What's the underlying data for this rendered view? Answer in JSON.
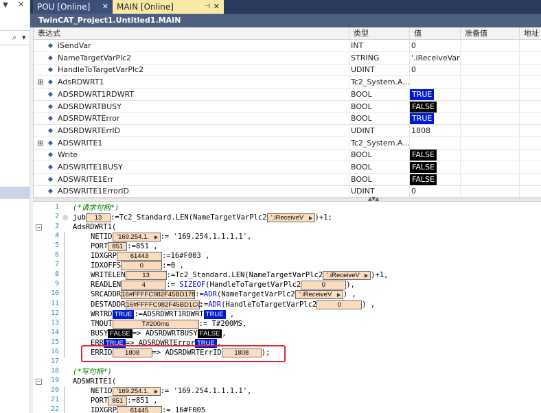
{
  "left_panel": {
    "search_icon_glyph": "⌕",
    "dropdown_glyph": "▾"
  },
  "tabs": [
    {
      "label": "POU [Online]",
      "active": false
    },
    {
      "label": "MAIN [Online]",
      "active": true
    }
  ],
  "window_title": "TwinCAT_Project1.Untitled1.MAIN",
  "watch_table": {
    "columns": [
      "表达式",
      "类型",
      "值",
      "准备值",
      "地址"
    ],
    "rows": [
      {
        "expand": "",
        "name": "iSendVar",
        "type": "INT",
        "value": "0",
        "kind": "text"
      },
      {
        "expand": "",
        "name": "NameTargetVarPlc2",
        "type": "STRING",
        "value": "'.iReceiveVar'",
        "kind": "text"
      },
      {
        "expand": "",
        "name": "HandleToTargetVarPlc2",
        "type": "UDINT",
        "value": "0",
        "kind": "text"
      },
      {
        "expand": "⊞",
        "name": "AdsRDWRT1",
        "type": "Tc2_System.A...",
        "value": "",
        "kind": "text"
      },
      {
        "expand": "",
        "name": "ADSRDWRT1RDWRT",
        "type": "BOOL",
        "value": "TRUE",
        "kind": "true"
      },
      {
        "expand": "",
        "name": "ADSRDWRTBUSY",
        "type": "BOOL",
        "value": "FALSE",
        "kind": "false"
      },
      {
        "expand": "",
        "name": "ADSRDWRTError",
        "type": "BOOL",
        "value": "TRUE",
        "kind": "true"
      },
      {
        "expand": "",
        "name": "ADSRDWRTErrID",
        "type": "UDINT",
        "value": "1808",
        "kind": "text"
      },
      {
        "expand": "⊞",
        "name": "ADSWRITE1",
        "type": "Tc2_System.A...",
        "value": "",
        "kind": "text"
      },
      {
        "expand": "",
        "name": "Write",
        "type": "BOOL",
        "value": "FALSE",
        "kind": "false"
      },
      {
        "expand": "",
        "name": "ADSWRITE1BUSY",
        "type": "BOOL",
        "value": "FALSE",
        "kind": "false"
      },
      {
        "expand": "",
        "name": "ADSWRITE1Err",
        "type": "BOOL",
        "value": "FALSE",
        "kind": "false"
      },
      {
        "expand": "",
        "name": "ADSWRITE1ErrorID",
        "type": "UDINT",
        "value": "0",
        "kind": "text"
      }
    ]
  },
  "code_lines": [
    {
      "n": "1",
      "fold": "",
      "indent": 0,
      "parts": [
        {
          "c": "(*请求句柄*)",
          "k": "cm"
        }
      ]
    },
    {
      "n": "2",
      "fold": "",
      "indent": 0,
      "parts": [
        {
          "c": "jub",
          "k": ""
        },
        {
          "c": "13",
          "k": "std",
          "w": 36
        },
        {
          "c": ":=Tc2_Standard.LEN(NameTargetVarPlc2",
          "k": ""
        },
        {
          "c": "'.iReceiveV",
          "k": "str",
          "w": 70
        },
        {
          "c": ")+1;",
          "k": ""
        }
      ]
    },
    {
      "n": "3",
      "fold": "⊟",
      "indent": 0,
      "parts": [
        {
          "c": "AdsRDWRT1(",
          "k": ""
        }
      ]
    },
    {
      "n": "4",
      "fold": "",
      "indent": 1,
      "parts": [
        {
          "c": "NETID",
          "k": ""
        },
        {
          "c": "'169.254.1.",
          "k": "str",
          "w": 70
        },
        {
          "c": ":= '169.254.1.1.1.1',",
          "k": ""
        }
      ]
    },
    {
      "n": "5",
      "fold": "",
      "indent": 1,
      "parts": [
        {
          "c": "PORT",
          "k": ""
        },
        {
          "c": "851",
          "k": "std",
          "w": 28
        },
        {
          "c": ":=851 ,",
          "k": ""
        }
      ]
    },
    {
      "n": "6",
      "fold": "",
      "indent": 1,
      "parts": [
        {
          "c": "IDXGRP",
          "k": ""
        },
        {
          "c": "61443",
          "k": "std",
          "w": 66
        },
        {
          "c": ":=16#F003 ,",
          "k": ""
        }
      ]
    },
    {
      "n": "7",
      "fold": "",
      "indent": 1,
      "parts": [
        {
          "c": "IDXOFFS",
          "k": ""
        },
        {
          "c": "0",
          "k": "std",
          "w": 60
        },
        {
          "c": ":=0 ,",
          "k": ""
        }
      ]
    },
    {
      "n": "8",
      "fold": "",
      "indent": 1,
      "parts": [
        {
          "c": "WRITELEN",
          "k": ""
        },
        {
          "c": "13",
          "k": "std",
          "w": 60
        },
        {
          "c": ":=Tc2_Standard.LEN(NameTargetVarPlc2",
          "k": ""
        },
        {
          "c": "'.iReceiveV",
          "k": "str",
          "w": 70
        },
        {
          "c": ")+1,",
          "k": ""
        }
      ]
    },
    {
      "n": "9",
      "fold": "",
      "indent": 1,
      "parts": [
        {
          "c": "READLEN",
          "k": ""
        },
        {
          "c": "4",
          "k": "std",
          "w": 66
        },
        {
          "c": ":= ",
          "k": ""
        },
        {
          "c": "SIZEOF",
          "k": "kw"
        },
        {
          "c": "(HandleToTargetVarPlc2",
          "k": ""
        },
        {
          "c": "0",
          "k": "std",
          "w": 66
        },
        {
          "c": "),",
          "k": ""
        }
      ]
    },
    {
      "n": "10",
      "fold": "",
      "indent": 1,
      "parts": [
        {
          "c": "SRCADDR",
          "k": ""
        },
        {
          "c": "16#FFFFC982F45BD178",
          "k": "std",
          "w": 108
        },
        {
          "c": ":=",
          "k": ""
        },
        {
          "c": "ADR",
          "k": "kw"
        },
        {
          "c": "(NameTargetVarPlc2",
          "k": ""
        },
        {
          "c": "'.iReceiveV",
          "k": "str",
          "w": 70
        },
        {
          "c": ") ,",
          "k": ""
        }
      ]
    },
    {
      "n": "11",
      "fold": "",
      "indent": 1,
      "parts": [
        {
          "c": "DESTADDR",
          "k": ""
        },
        {
          "c": "16#FFFFC982F45BD1CC",
          "k": "std",
          "w": 108
        },
        {
          "c": ":=",
          "k": ""
        },
        {
          "c": "ADR",
          "k": "kw"
        },
        {
          "c": "(HandleToTargetVarPlc2",
          "k": ""
        },
        {
          "c": "0",
          "k": "std",
          "w": 66
        },
        {
          "c": ") ,",
          "k": ""
        }
      ]
    },
    {
      "n": "12",
      "fold": "",
      "indent": 1,
      "parts": [
        {
          "c": "WRTRD",
          "k": ""
        },
        {
          "c": "TRUE",
          "k": "t"
        },
        {
          "c": ":=ADSRDWRT1RDWRT",
          "k": ""
        },
        {
          "c": "TRUE",
          "k": "t"
        },
        {
          "c": " ,",
          "k": ""
        }
      ]
    },
    {
      "n": "13",
      "fold": "",
      "indent": 1,
      "parts": [
        {
          "c": "TMOUT",
          "k": ""
        },
        {
          "c": "T#200ms",
          "k": "std",
          "w": 126
        },
        {
          "c": ":= T#200MS,",
          "k": ""
        }
      ]
    },
    {
      "n": "14",
      "fold": "",
      "indent": 1,
      "parts": [
        {
          "c": "BUSY",
          "k": ""
        },
        {
          "c": "FALSE",
          "k": "f"
        },
        {
          "c": "=> ADSRDWRTBUSY",
          "k": ""
        },
        {
          "c": "FALSE",
          "k": "f"
        },
        {
          "c": ",",
          "k": ""
        }
      ]
    },
    {
      "n": "15",
      "fold": "",
      "indent": 1,
      "parts": [
        {
          "c": "ERR",
          "k": ""
        },
        {
          "c": "TRUE",
          "k": "t"
        },
        {
          "c": "=> ADSRDWRTError",
          "k": ""
        },
        {
          "c": "TRUE",
          "k": "t"
        },
        {
          "c": ",",
          "k": ""
        }
      ]
    },
    {
      "n": "16",
      "fold": "",
      "indent": 1,
      "parts": [
        {
          "c": "ERRID",
          "k": ""
        },
        {
          "c": "1808",
          "k": "std",
          "w": 58
        },
        {
          "c": "=> ADSRDWRTErrID",
          "k": ""
        },
        {
          "c": "1808",
          "k": "std",
          "w": 58
        },
        {
          "c": ");",
          "k": ""
        }
      ]
    },
    {
      "n": "17",
      "fold": "",
      "indent": 0,
      "parts": []
    },
    {
      "n": "18",
      "fold": "",
      "indent": 0,
      "parts": [
        {
          "c": "(*写句柄*)",
          "k": "cm"
        }
      ]
    },
    {
      "n": "19",
      "fold": "⊟",
      "indent": 0,
      "parts": [
        {
          "c": "ADSWRITE1(",
          "k": ""
        }
      ]
    },
    {
      "n": "20",
      "fold": "",
      "indent": 1,
      "parts": [
        {
          "c": "NETID",
          "k": ""
        },
        {
          "c": "'169.254.1.",
          "k": "str",
          "w": 70
        },
        {
          "c": ":= '169.254.1.1.1.1',",
          "k": ""
        }
      ]
    },
    {
      "n": "21",
      "fold": "",
      "indent": 1,
      "parts": [
        {
          "c": "PORT",
          "k": ""
        },
        {
          "c": "851",
          "k": "std",
          "w": 28
        },
        {
          "c": ":=851 ,",
          "k": ""
        }
      ]
    },
    {
      "n": "22",
      "fold": "",
      "indent": 1,
      "parts": [
        {
          "c": "IDXGRP",
          "k": ""
        },
        {
          "c": "61445",
          "k": "std",
          "w": 66
        },
        {
          "c": ":= 16#F005",
          "k": ""
        }
      ]
    }
  ],
  "colors": {
    "true_bg": "#0019d6",
    "false_bg": "#000000",
    "highlight_box": "#e8202a",
    "overlay_bg": "#fcdcbf"
  }
}
